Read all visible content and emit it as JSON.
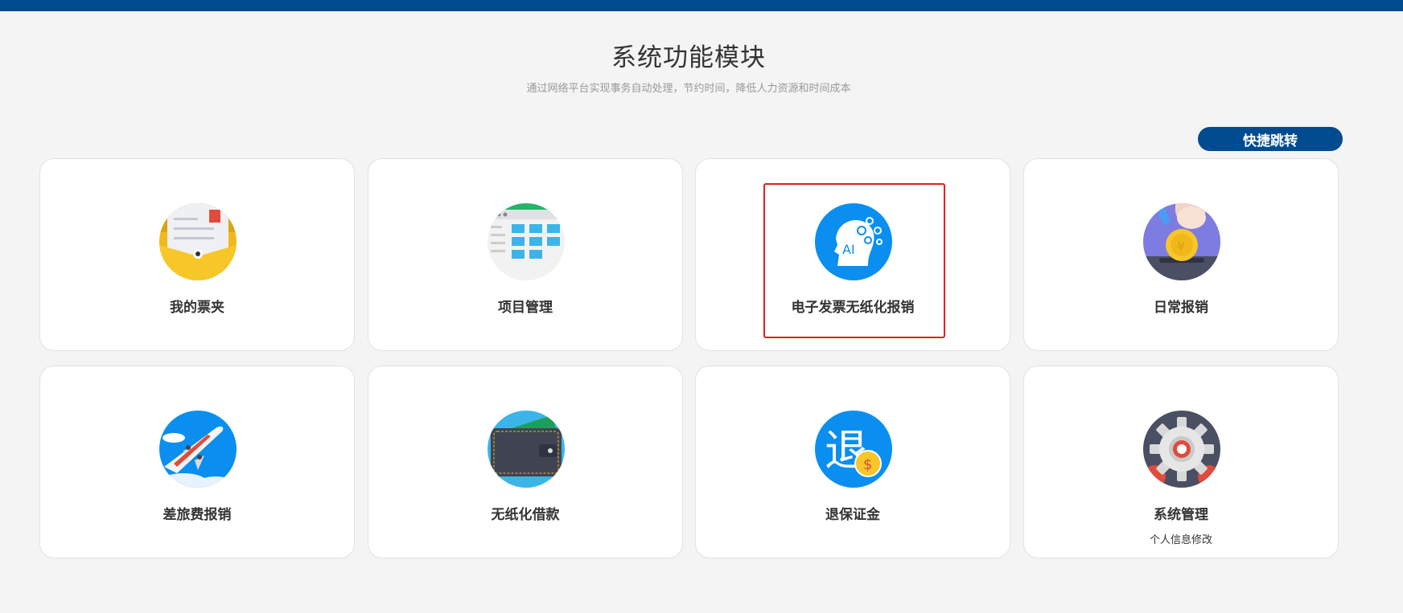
{
  "header": {
    "title": "系统功能模块",
    "subtitle": "通过网络平台实现事务自动处理，节约时间，降低人力资源和时间成本"
  },
  "quick_jump": {
    "label": "快捷跳转"
  },
  "modules": [
    {
      "label": "我的票夹",
      "icon": "invoice-folder-icon"
    },
    {
      "label": "项目管理",
      "icon": "project-calendar-icon"
    },
    {
      "label": "电子发票无纸化报销",
      "icon": "ai-head-icon",
      "ai_text": "AI"
    },
    {
      "label": "日常报销",
      "icon": "coin-hand-icon"
    },
    {
      "label": "差旅费报销",
      "icon": "airplane-icon"
    },
    {
      "label": "无纸化借款",
      "icon": "wallet-icon"
    },
    {
      "label": "退保证金",
      "icon": "refund-deposit-icon",
      "glyph": "退",
      "coin": "$"
    },
    {
      "label": "系统管理",
      "icon": "gear-icon",
      "sublabel": "个人信息修改"
    }
  ],
  "colors": {
    "brand": "#004a8f",
    "highlight": "#e02020",
    "icon_blue": "#0a8ff0"
  }
}
